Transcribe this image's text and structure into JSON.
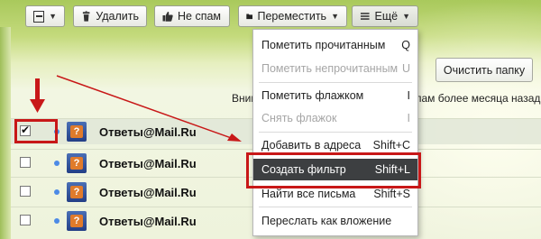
{
  "toolbar": {
    "delete_label": "Удалить",
    "not_spam_label": "Не спам",
    "move_label": "Переместить",
    "more_label": "Ещё"
  },
  "clear_folder_label": "Очистить папку",
  "notice": {
    "left": "Внима",
    "right": "спам более месяца назад"
  },
  "messages": [
    {
      "sender": "Ответы@Mail.Ru",
      "checked": true,
      "unread": true
    },
    {
      "sender": "Ответы@Mail.Ru",
      "checked": false,
      "unread": true
    },
    {
      "sender": "Ответы@Mail.Ru",
      "checked": false,
      "unread": true
    },
    {
      "sender": "Ответы@Mail.Ru",
      "checked": false,
      "unread": true
    }
  ],
  "menu": {
    "items": [
      {
        "label": "Пометить прочитанным",
        "shortcut": "Q",
        "disabled": false
      },
      {
        "label": "Пометить непрочитанным",
        "shortcut": "U",
        "disabled": true
      },
      {
        "label": "Пометить флажком",
        "shortcut": "I",
        "disabled": false
      },
      {
        "label": "Снять флажок",
        "shortcut": "I",
        "disabled": true
      },
      {
        "label": "Добавить в адреса",
        "shortcut": "Shift+C",
        "disabled": false
      },
      {
        "label": "Создать фильтр",
        "shortcut": "Shift+L",
        "disabled": false,
        "highlighted": true
      },
      {
        "label": "Найти все письма",
        "shortcut": "Shift+S",
        "disabled": false
      },
      {
        "label": "Переслать как вложение",
        "shortcut": "",
        "disabled": false
      }
    ]
  },
  "colors": {
    "annotation_red": "#c81818",
    "menu_highlight": "#3d3f41",
    "unread_dot": "#4c8ae6"
  }
}
